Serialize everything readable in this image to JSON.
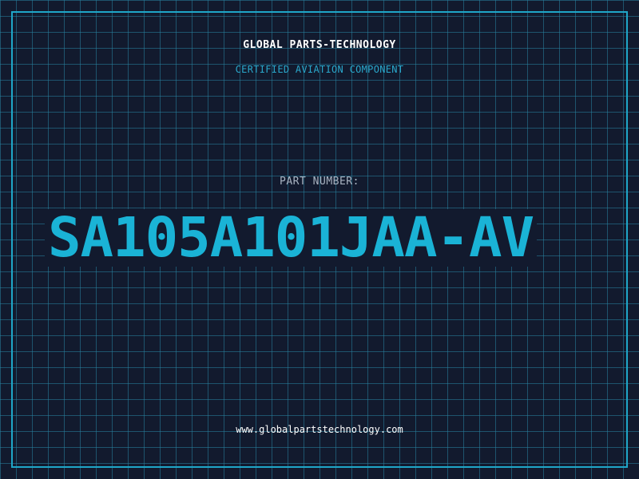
{
  "header": {
    "company": "GLOBAL PARTS-TECHNOLOGY",
    "tagline": "CERTIFIED AVIATION COMPONENT"
  },
  "part": {
    "label": "PART NUMBER:",
    "number": "SA105A101JAA-AV"
  },
  "footer": {
    "website": "www.globalpartstechnology.com"
  },
  "colors": {
    "background": "#121a2e",
    "grid": "#2882a0",
    "accent": "#1fa6c8",
    "part_number": "#1ab3d6",
    "label": "#a9b4c2",
    "text": "#ffffff"
  }
}
